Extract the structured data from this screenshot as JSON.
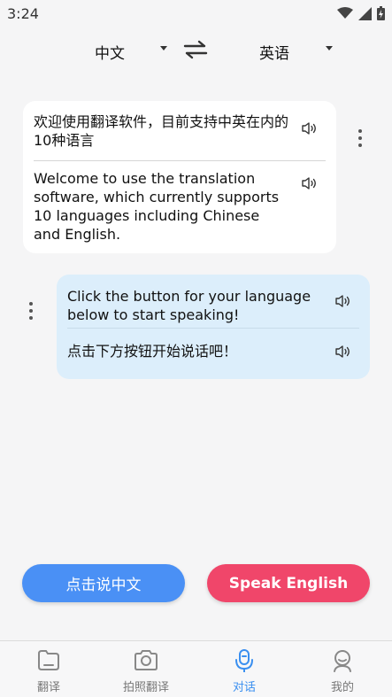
{
  "status_bar": {
    "time": "3:24"
  },
  "lang_bar": {
    "source": "中文",
    "target": "英语"
  },
  "messages": [
    {
      "side": "left",
      "original": "欢迎使用翻译软件，目前支持中英在内的10种语言",
      "translation": "Welcome to use the translation software, which currently supports 10 languages including Chinese and English."
    },
    {
      "side": "right",
      "original": "Click the button for your language below to start speaking!",
      "translation": "点击下方按钮开始说话吧！"
    }
  ],
  "buttons": {
    "speak_chinese": "点击说中文",
    "speak_english": "Speak English"
  },
  "tabs": [
    {
      "label": "翻译",
      "icon": "folder-icon",
      "active": false
    },
    {
      "label": "拍照翻译",
      "icon": "camera-icon",
      "active": false
    },
    {
      "label": "对话",
      "icon": "microphone-icon",
      "active": true
    },
    {
      "label": "我的",
      "icon": "user-icon",
      "active": false
    }
  ],
  "colors": {
    "accent_blue": "#4a90f5",
    "accent_pink": "#f0466a",
    "tab_active": "#3a8ff0",
    "right_bubble": "#dceefb"
  }
}
